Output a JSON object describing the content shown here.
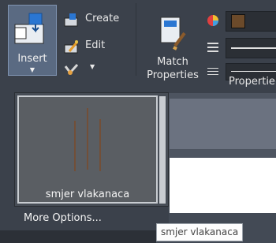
{
  "ribbon": {
    "insert_label": "Insert",
    "insert_arrow": "▼",
    "create_label": "Create",
    "edit_label": "Edit",
    "third_arrow": "▼",
    "match_properties_label": "Match Properties",
    "properties_panel_label": "Propertie"
  },
  "gallery": {
    "tile_label": "smjer vlakanaca",
    "more_options_label": "More Options..."
  },
  "tooltip": {
    "text": "smjer vlakanaca"
  },
  "colors": {
    "ribbon_bg": "#3b414b",
    "highlight_blue": "#5a6a82",
    "tile_border": "#c8ccd1",
    "tile_line": "#7a4a2a"
  },
  "icons": [
    "insert-block-icon",
    "create-block-icon",
    "edit-block-icon",
    "attribute-icon",
    "match-properties-icon",
    "color-wheel-icon",
    "linetype-icon",
    "lineweight-icon"
  ]
}
